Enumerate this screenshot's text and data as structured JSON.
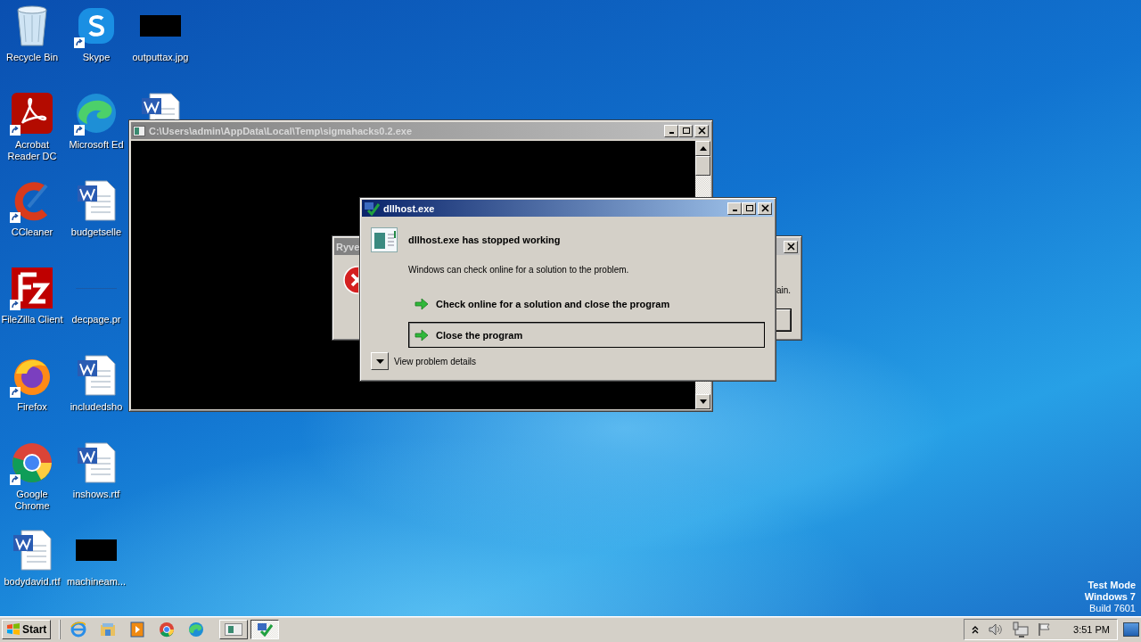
{
  "desktop": {
    "icons": [
      {
        "label": "Recycle Bin",
        "kind": "recycle",
        "shortcut": false
      },
      {
        "label": "Acrobat Reader DC",
        "kind": "acrobat",
        "shortcut": true
      },
      {
        "label": "CCleaner",
        "kind": "ccleaner",
        "shortcut": true
      },
      {
        "label": "FileZilla Client",
        "kind": "filezilla",
        "shortcut": true
      },
      {
        "label": "Firefox",
        "kind": "firefox",
        "shortcut": true
      },
      {
        "label": "Google Chrome",
        "kind": "chrome",
        "shortcut": true
      },
      {
        "label": "bodydavid.rtf",
        "kind": "word",
        "shortcut": false
      },
      {
        "label": "Skype",
        "kind": "skype",
        "shortcut": true
      },
      {
        "label": "Microsoft Ed",
        "kind": "edge",
        "shortcut": true
      },
      {
        "label": "budgetselle",
        "kind": "word",
        "shortcut": false
      },
      {
        "label": "decpage.pr",
        "kind": "blank",
        "shortcut": false
      },
      {
        "label": "includedsho",
        "kind": "word",
        "shortcut": false
      },
      {
        "label": "inshows.rtf",
        "kind": "word",
        "shortcut": false
      },
      {
        "label": "machineam...",
        "kind": "image",
        "shortcut": false
      },
      {
        "label": "outputtax.jpg",
        "kind": "image",
        "shortcut": false
      },
      {
        "kind": "word",
        "shortcut": false
      }
    ]
  },
  "system_notice": [
    "Test Mode",
    "Windows 7",
    "Build 7601"
  ],
  "console_window": {
    "title": "C:\\Users\\admin\\AppData\\Local\\Temp\\sigmahacks0.2.exe",
    "active": false
  },
  "error_window": {
    "title": "Ryve",
    "message": "ain.",
    "active": false
  },
  "problem_dialog": {
    "title": "dllhost.exe",
    "active": true,
    "heading": "dllhost.exe has stopped working",
    "description": "Windows can check online for a solution to the problem.",
    "commands": [
      {
        "label": "Check online for a solution and close the program",
        "focused": false
      },
      {
        "label": "Close the program",
        "focused": true
      }
    ],
    "details": {
      "label": "View problem details",
      "expanded": false
    }
  },
  "taskbar": {
    "start": "Start",
    "quick_launch": [
      {
        "kind": "ie"
      },
      {
        "kind": "explorer"
      },
      {
        "kind": "media"
      },
      {
        "kind": "chrome"
      },
      {
        "kind": "edge"
      }
    ],
    "tasks": [
      {
        "kind": "console",
        "selected": false
      },
      {
        "kind": "dllhost",
        "selected": true
      }
    ],
    "tray": {
      "clock": "3:51 PM"
    }
  }
}
